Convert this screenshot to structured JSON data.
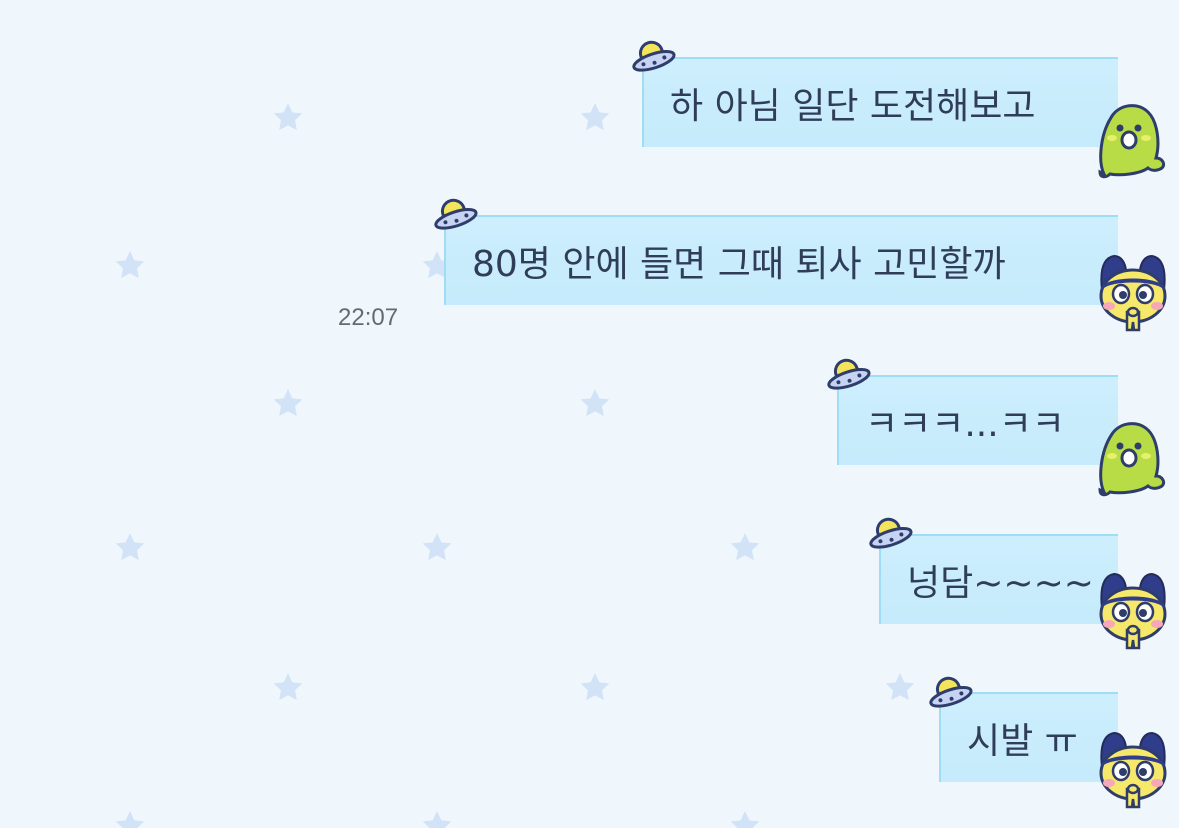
{
  "colors": {
    "background": "#eff7fd",
    "bubble": "#c5ebfc",
    "bubble_border": "#9fdcf6",
    "text": "#2f3d59",
    "star": "#d2e3f7"
  },
  "messages": [
    {
      "text": "하 아님 일단 도전해보고",
      "avatar": "green-blob-avatar",
      "decoration": "ufo-icon"
    },
    {
      "text": "80명 안에 들면 그때 퇴사 고민할까",
      "avatar": "navy-rabbit-avatar",
      "decoration": "ufo-icon",
      "time": "22:07"
    },
    {
      "text": "ㅋㅋㅋ...ㅋㅋ",
      "avatar": "green-blob-avatar",
      "decoration": "ufo-icon"
    },
    {
      "text": "넝담~~~~",
      "avatar": "navy-rabbit-avatar",
      "decoration": "ufo-icon"
    },
    {
      "text": "시발 ㅠ",
      "avatar": "navy-rabbit-avatar",
      "decoration": "ufo-icon"
    }
  ]
}
